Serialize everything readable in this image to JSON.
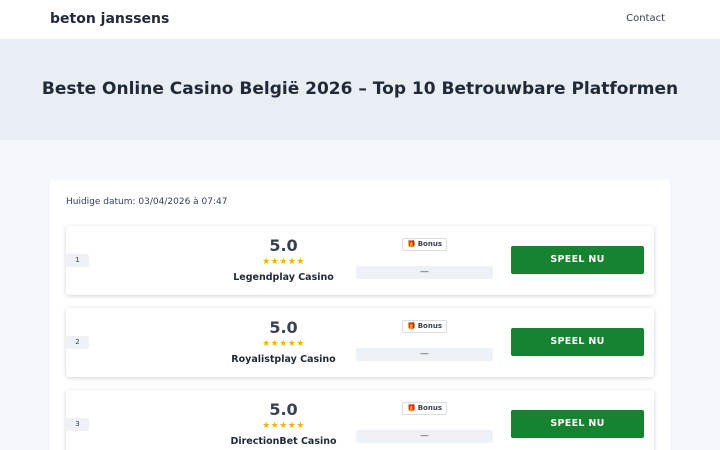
{
  "header": {
    "brand": "beton janssens",
    "nav_contact": "Contact"
  },
  "hero": {
    "title": "Beste Online Casino België 2026 – Top 10 Betrouwbare Platformen"
  },
  "main": {
    "date_line": "Huidige datum: 03/04/2026 à 07:47",
    "cards": [
      {
        "rank": "1",
        "score": "5.0",
        "stars": "★★★★★",
        "rating_out_of_5": 5,
        "name": "Legendplay Casino",
        "bonus_label": "Bonus",
        "bonus_icon": "gift-icon",
        "bonus_value": "—",
        "cta": "SPEEL NU"
      },
      {
        "rank": "2",
        "score": "5.0",
        "stars": "★★★★★",
        "rating_out_of_5": 5,
        "name": "Royalistplay Casino",
        "bonus_label": "Bonus",
        "bonus_icon": "gift-icon",
        "bonus_value": "—",
        "cta": "SPEEL NU"
      },
      {
        "rank": "3",
        "score": "5.0",
        "stars": "★★★★★",
        "rating_out_of_5": 5,
        "name": "DirectionBet Casino",
        "bonus_label": "Bonus",
        "bonus_icon": "gift-icon",
        "bonus_value": "—",
        "cta": "SPEEL NU"
      }
    ]
  },
  "colors": {
    "cta_green": "#15832f",
    "star_gold": "#f5b301",
    "hero_bg": "#e9eef4",
    "page_bg": "#f4f7fb"
  }
}
